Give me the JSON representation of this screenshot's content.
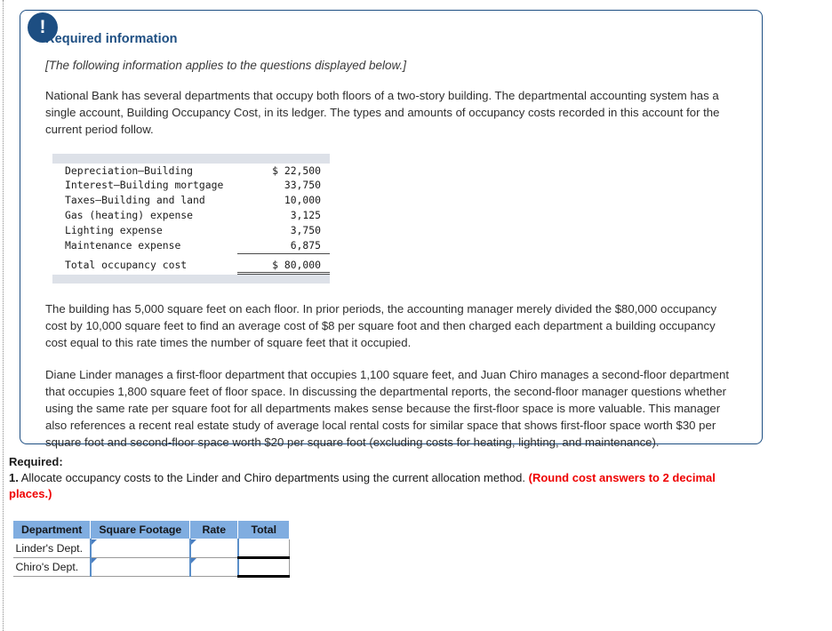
{
  "alert": {
    "icon": "exclamation-icon",
    "glyph": "!"
  },
  "callout": {
    "title": "Required information",
    "italic_note": "[The following information applies to the questions displayed below.]",
    "paragraph_1": "National Bank has several departments that occupy both floors of a two-story building. The departmental accounting system has a single account, Building Occupancy Cost, in its ledger. The types and amounts of occupancy costs recorded in this account for the current period follow.",
    "paragraph_2": "The building has 5,000 square feet on each floor. In prior periods, the accounting manager merely divided the $80,000 occupancy cost by 10,000 square feet to find an average cost of $8 per square foot and then charged each department a building occupancy cost equal to this rate times the number of square feet that it occupied.",
    "paragraph_3": "Diane Linder manages a first-floor department that occupies 1,100 square feet, and Juan Chiro manages a second-floor department that occupies 1,800 square feet of floor space. In discussing the departmental reports, the second-floor manager questions whether using the same rate per square foot for all departments makes sense because the first-floor space is more valuable. This manager also references a recent real estate study of average local rental costs for similar space that shows first-floor space worth $30 per square foot and second-floor space worth $20 per square foot (excluding costs for heating, lighting, and maintenance)."
  },
  "cost_table": {
    "rows": [
      {
        "label": "Depreciation—Building",
        "amount": "$ 22,500"
      },
      {
        "label": "Interest—Building mortgage",
        "amount": "33,750"
      },
      {
        "label": "Taxes—Building and land",
        "amount": "10,000"
      },
      {
        "label": "Gas (heating) expense",
        "amount": "3,125"
      },
      {
        "label": "Lighting expense",
        "amount": "3,750"
      },
      {
        "label": "Maintenance expense",
        "amount": "6,875"
      }
    ],
    "total_label": "Total occupancy cost",
    "total_amount": "$ 80,000"
  },
  "required": {
    "heading": "Required:",
    "item_number": "1.",
    "item_text": " Allocate occupancy costs to the Linder and Chiro departments using the current allocation method. ",
    "red_note": "(Round cost answers to 2 decimal places.)"
  },
  "answer_grid": {
    "headers": [
      "Department",
      "Square Footage",
      "Rate",
      "Total"
    ],
    "rows": [
      {
        "department": "Linder's Dept.",
        "square_footage": "",
        "rate": "",
        "total": ""
      },
      {
        "department": "Chiro's Dept.",
        "square_footage": "",
        "rate": "",
        "total": ""
      }
    ]
  },
  "colors": {
    "callout_border": "#1d4e82",
    "title_blue": "#1d4e82",
    "header_blue": "#80ade0",
    "red": "#ef0000",
    "mono_bar": "#dde1e8"
  }
}
